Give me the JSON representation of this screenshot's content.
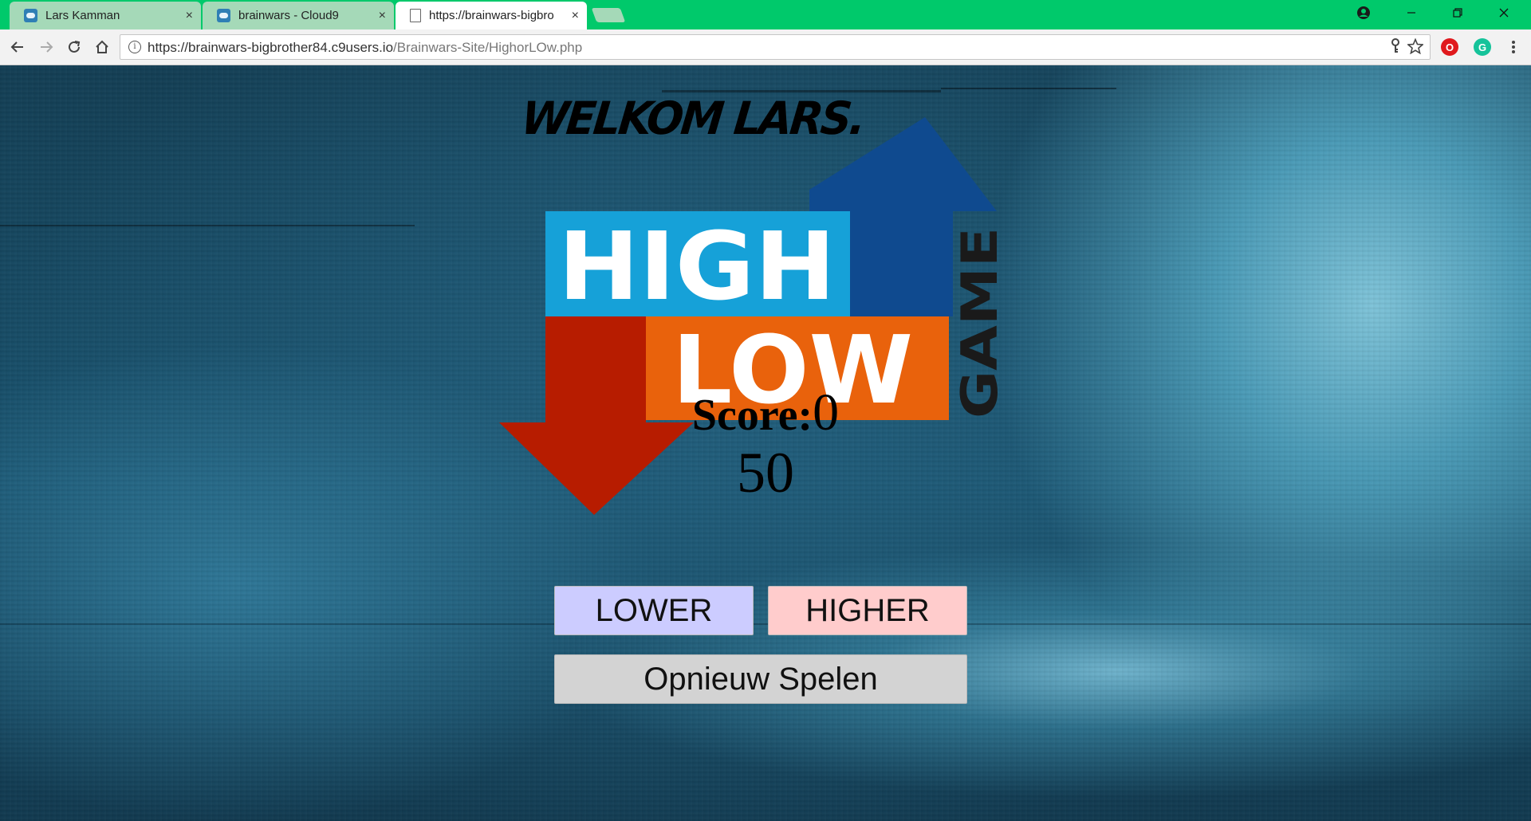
{
  "browser": {
    "tabs": [
      {
        "label": "Lars Kamman",
        "favicon": "cloud9-icon",
        "active": false
      },
      {
        "label": "brainwars - Cloud9",
        "favicon": "cloud9-icon",
        "active": false
      },
      {
        "label": "https://brainwars-bigbro",
        "favicon": "page-icon",
        "active": true
      }
    ],
    "close_glyph": "×",
    "url_host": "https://brainwars-bigbrother84.c9users.io",
    "url_path": "/Brainwars-Site/HighorLOw.php",
    "theme_color": "#00c96b"
  },
  "page": {
    "welcome": "WELKOM LARS.",
    "logo": {
      "high": "HIGH",
      "low": "LOW",
      "game": "GAME",
      "colors": {
        "high_bg": "#16a1d8",
        "low_bg": "#e9620c",
        "up_arrow": "#0f4a8f",
        "down_arrow": "#b71c00",
        "game_text": "#1a1a1a"
      }
    },
    "score_label": "Score:",
    "score_value": "0",
    "current_number": "50",
    "buttons": {
      "lower": "LOWER",
      "higher": "HIGHER",
      "replay": "Opnieuw Spelen"
    },
    "button_colors": {
      "lower": "#ccccff",
      "higher": "#ffcccc",
      "replay": "#d3d3d3"
    }
  }
}
